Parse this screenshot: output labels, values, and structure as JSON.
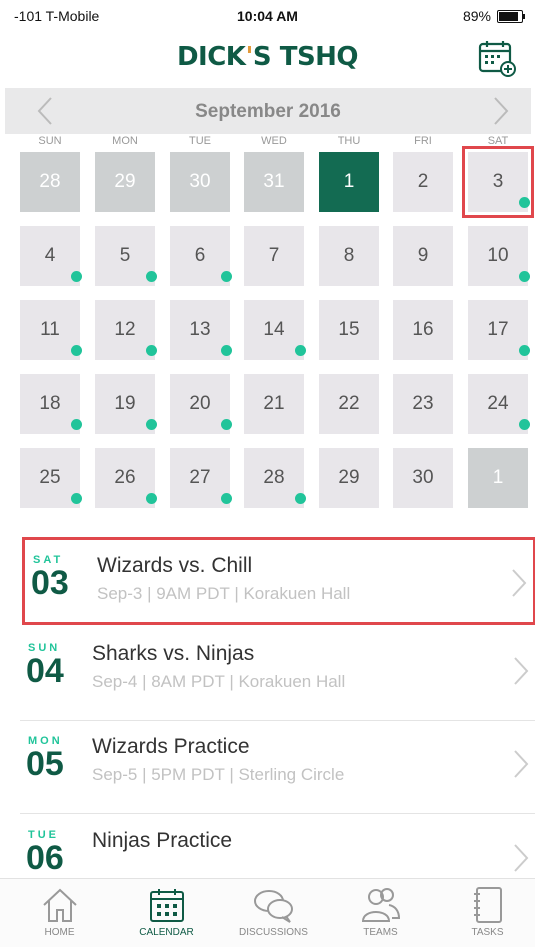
{
  "status_bar": {
    "carrier": "-101 T-Mobile",
    "time": "10:04 AM",
    "battery": "89%"
  },
  "header": {
    "logo_main": "DICK",
    "logo_apos": "'",
    "logo_s": "S",
    "logo_rest": " TSHQ"
  },
  "calendar": {
    "month_title": "September 2016",
    "weekdays": [
      "SUN",
      "MON",
      "TUE",
      "WED",
      "THU",
      "FRI",
      "SAT"
    ],
    "weeks": [
      [
        {
          "d": "28",
          "other": true
        },
        {
          "d": "29",
          "other": true
        },
        {
          "d": "30",
          "other": true
        },
        {
          "d": "31",
          "other": true
        },
        {
          "d": "1",
          "today": true
        },
        {
          "d": "2"
        },
        {
          "d": "3",
          "dot": true,
          "selected": true
        }
      ],
      [
        {
          "d": "4",
          "dot": true
        },
        {
          "d": "5",
          "dot": true
        },
        {
          "d": "6",
          "dot": true
        },
        {
          "d": "7"
        },
        {
          "d": "8"
        },
        {
          "d": "9"
        },
        {
          "d": "10",
          "dot": true
        }
      ],
      [
        {
          "d": "11",
          "dot": true
        },
        {
          "d": "12",
          "dot": true
        },
        {
          "d": "13",
          "dot": true
        },
        {
          "d": "14",
          "dot": true
        },
        {
          "d": "15"
        },
        {
          "d": "16"
        },
        {
          "d": "17",
          "dot": true
        }
      ],
      [
        {
          "d": "18",
          "dot": true
        },
        {
          "d": "19",
          "dot": true
        },
        {
          "d": "20",
          "dot": true
        },
        {
          "d": "21"
        },
        {
          "d": "22"
        },
        {
          "d": "23"
        },
        {
          "d": "24",
          "dot": true
        }
      ],
      [
        {
          "d": "25",
          "dot": true
        },
        {
          "d": "26",
          "dot": true
        },
        {
          "d": "27",
          "dot": true
        },
        {
          "d": "28",
          "dot": true
        },
        {
          "d": "29"
        },
        {
          "d": "30"
        },
        {
          "d": "1",
          "other": true
        }
      ]
    ]
  },
  "events": [
    {
      "dow": "SAT",
      "day": "03",
      "title": "Wizards vs. Chill",
      "subtitle": "Sep-3 | 9AM PDT | Korakuen Hall",
      "highlight": true
    },
    {
      "dow": "SUN",
      "day": "04",
      "title": "Sharks vs. Ninjas",
      "subtitle": "Sep-4 | 8AM PDT | Korakuen Hall"
    },
    {
      "dow": "MON",
      "day": "05",
      "title": "Wizards Practice",
      "subtitle": "Sep-5 | 5PM PDT | Sterling Circle"
    },
    {
      "dow": "TUE",
      "day": "06",
      "title": "Ninjas Practice",
      "subtitle": ""
    }
  ],
  "tabs": [
    {
      "label": "HOME",
      "icon": "home-icon"
    },
    {
      "label": "CALENDAR",
      "icon": "calendar-icon",
      "active": true
    },
    {
      "label": "DISCUSSIONS",
      "icon": "discussions-icon"
    },
    {
      "label": "TEAMS",
      "icon": "teams-icon"
    },
    {
      "label": "TASKS",
      "icon": "tasks-icon"
    }
  ],
  "colors": {
    "brand_green": "#0f5a45",
    "accent_teal": "#21c49a",
    "highlight_red": "#e0474c"
  }
}
